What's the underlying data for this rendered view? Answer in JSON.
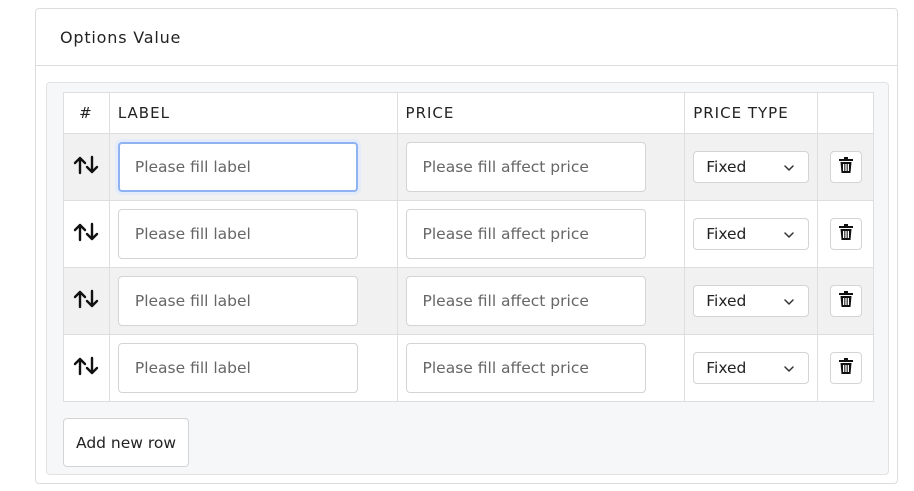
{
  "card": {
    "title": "Options Value"
  },
  "table": {
    "headers": {
      "num": "#",
      "label": "LABEL",
      "price": "PRICE",
      "price_type": "PRICE TYPE"
    },
    "rows": [
      {
        "label_value": "",
        "label_placeholder": "Please fill label",
        "price_value": "",
        "price_placeholder": "Please fill affect price",
        "price_type": "Fixed"
      },
      {
        "label_value": "",
        "label_placeholder": "Please fill label",
        "price_value": "",
        "price_placeholder": "Please fill affect price",
        "price_type": "Fixed"
      },
      {
        "label_value": "",
        "label_placeholder": "Please fill label",
        "price_value": "",
        "price_placeholder": "Please fill affect price",
        "price_type": "Fixed"
      },
      {
        "label_value": "",
        "label_placeholder": "Please fill label",
        "price_value": "",
        "price_placeholder": "Please fill affect price",
        "price_type": "Fixed"
      }
    ]
  },
  "actions": {
    "add_row_label": "Add new row"
  },
  "icons": {
    "sort": "sort-arrows-icon",
    "delete": "trash-icon",
    "select": "chevron-down-icon"
  },
  "colors": {
    "focus_border": "#8fb3f0",
    "row_alt": "#f1f1f1",
    "panel_bg": "#f6f7f8"
  }
}
